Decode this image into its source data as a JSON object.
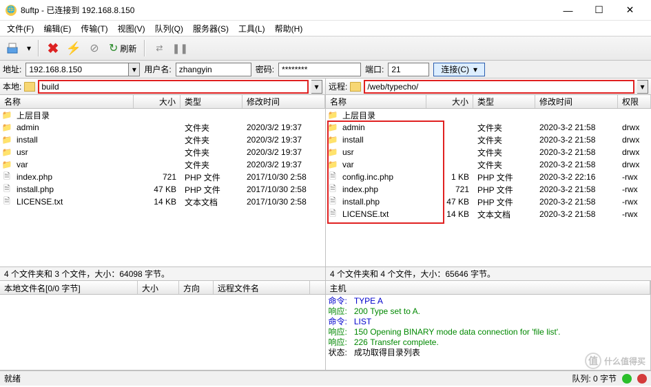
{
  "title": "8uftp - 已连接到 192.168.8.150",
  "menu": [
    "文件(F)",
    "编辑(E)",
    "传输(T)",
    "视图(V)",
    "队列(Q)",
    "服务器(S)",
    "工具(L)",
    "帮助(H)"
  ],
  "toolbar": {
    "refresh_label": "刷新"
  },
  "conn": {
    "address_label": "地址:",
    "address": "192.168.8.150",
    "user_label": "用户名:",
    "user": "zhangyin",
    "pass_label": "密码:",
    "pass": "********",
    "port_label": "端口:",
    "port": "21",
    "connect_label": "连接(C)"
  },
  "local": {
    "label": "本地:",
    "path": "build",
    "cols": [
      "名称",
      "大小",
      "类型",
      "修改时间"
    ],
    "updir": "上层目录",
    "rows": [
      {
        "icon": "folder",
        "name": "admin",
        "size": "",
        "type": "文件夹",
        "date": "2020/3/2 19:37"
      },
      {
        "icon": "folder",
        "name": "install",
        "size": "",
        "type": "文件夹",
        "date": "2020/3/2 19:37"
      },
      {
        "icon": "folder",
        "name": "usr",
        "size": "",
        "type": "文件夹",
        "date": "2020/3/2 19:37"
      },
      {
        "icon": "folder",
        "name": "var",
        "size": "",
        "type": "文件夹",
        "date": "2020/3/2 19:37"
      },
      {
        "icon": "file",
        "name": "index.php",
        "size": "721",
        "type": "PHP 文件",
        "date": "2017/10/30 2:58"
      },
      {
        "icon": "file",
        "name": "install.php",
        "size": "47 KB",
        "type": "PHP 文件",
        "date": "2017/10/30 2:58"
      },
      {
        "icon": "file",
        "name": "LICENSE.txt",
        "size": "14 KB",
        "type": "文本文档",
        "date": "2017/10/30 2:58"
      }
    ],
    "status": "4 个文件夹和 3 个文件，大小：64098 字节。"
  },
  "remote": {
    "label": "远程:",
    "path": "/web/typecho/",
    "cols": [
      "名称",
      "大小",
      "类型",
      "修改时间",
      "权限"
    ],
    "updir": "上层目录",
    "rows": [
      {
        "icon": "folder",
        "name": "admin",
        "size": "",
        "type": "文件夹",
        "date": "2020-3-2 21:58",
        "perm": "drwx"
      },
      {
        "icon": "folder",
        "name": "install",
        "size": "",
        "type": "文件夹",
        "date": "2020-3-2 21:58",
        "perm": "drwx"
      },
      {
        "icon": "folder",
        "name": "usr",
        "size": "",
        "type": "文件夹",
        "date": "2020-3-2 21:58",
        "perm": "drwx"
      },
      {
        "icon": "folder",
        "name": "var",
        "size": "",
        "type": "文件夹",
        "date": "2020-3-2 21:58",
        "perm": "drwx"
      },
      {
        "icon": "file",
        "name": "config.inc.php",
        "size": "1 KB",
        "type": "PHP 文件",
        "date": "2020-3-2 22:16",
        "perm": "-rwx"
      },
      {
        "icon": "file",
        "name": "index.php",
        "size": "721",
        "type": "PHP 文件",
        "date": "2020-3-2 21:58",
        "perm": "-rwx"
      },
      {
        "icon": "file",
        "name": "install.php",
        "size": "47 KB",
        "type": "PHP 文件",
        "date": "2020-3-2 21:58",
        "perm": "-rwx"
      },
      {
        "icon": "file",
        "name": "LICENSE.txt",
        "size": "14 KB",
        "type": "文本文档",
        "date": "2020-3-2 21:58",
        "perm": "-rwx"
      }
    ],
    "status": "4 个文件夹和 4 个文件，大小：65646 字节。"
  },
  "queue": {
    "cols": [
      "本地文件名[0/0 字节]",
      "大小",
      "方向",
      "远程文件名"
    ],
    "cols_r": [
      "主机"
    ]
  },
  "log": [
    {
      "cls": "c-blue",
      "label": "命令:",
      "text": "TYPE A"
    },
    {
      "cls": "c-green",
      "label": "响应:",
      "text": "200 Type set to A."
    },
    {
      "cls": "c-blue",
      "label": "命令:",
      "text": "LIST"
    },
    {
      "cls": "c-green",
      "label": "响应:",
      "text": "150 Opening BINARY mode data connection for 'file list'."
    },
    {
      "cls": "c-green",
      "label": "响应:",
      "text": "226 Transfer complete."
    },
    {
      "cls": "c-black",
      "label": "状态:",
      "text": "成功取得目录列表"
    }
  ],
  "footer": {
    "left": "就绪",
    "queue": "队列: 0 字节"
  },
  "watermark": "什么值得买"
}
